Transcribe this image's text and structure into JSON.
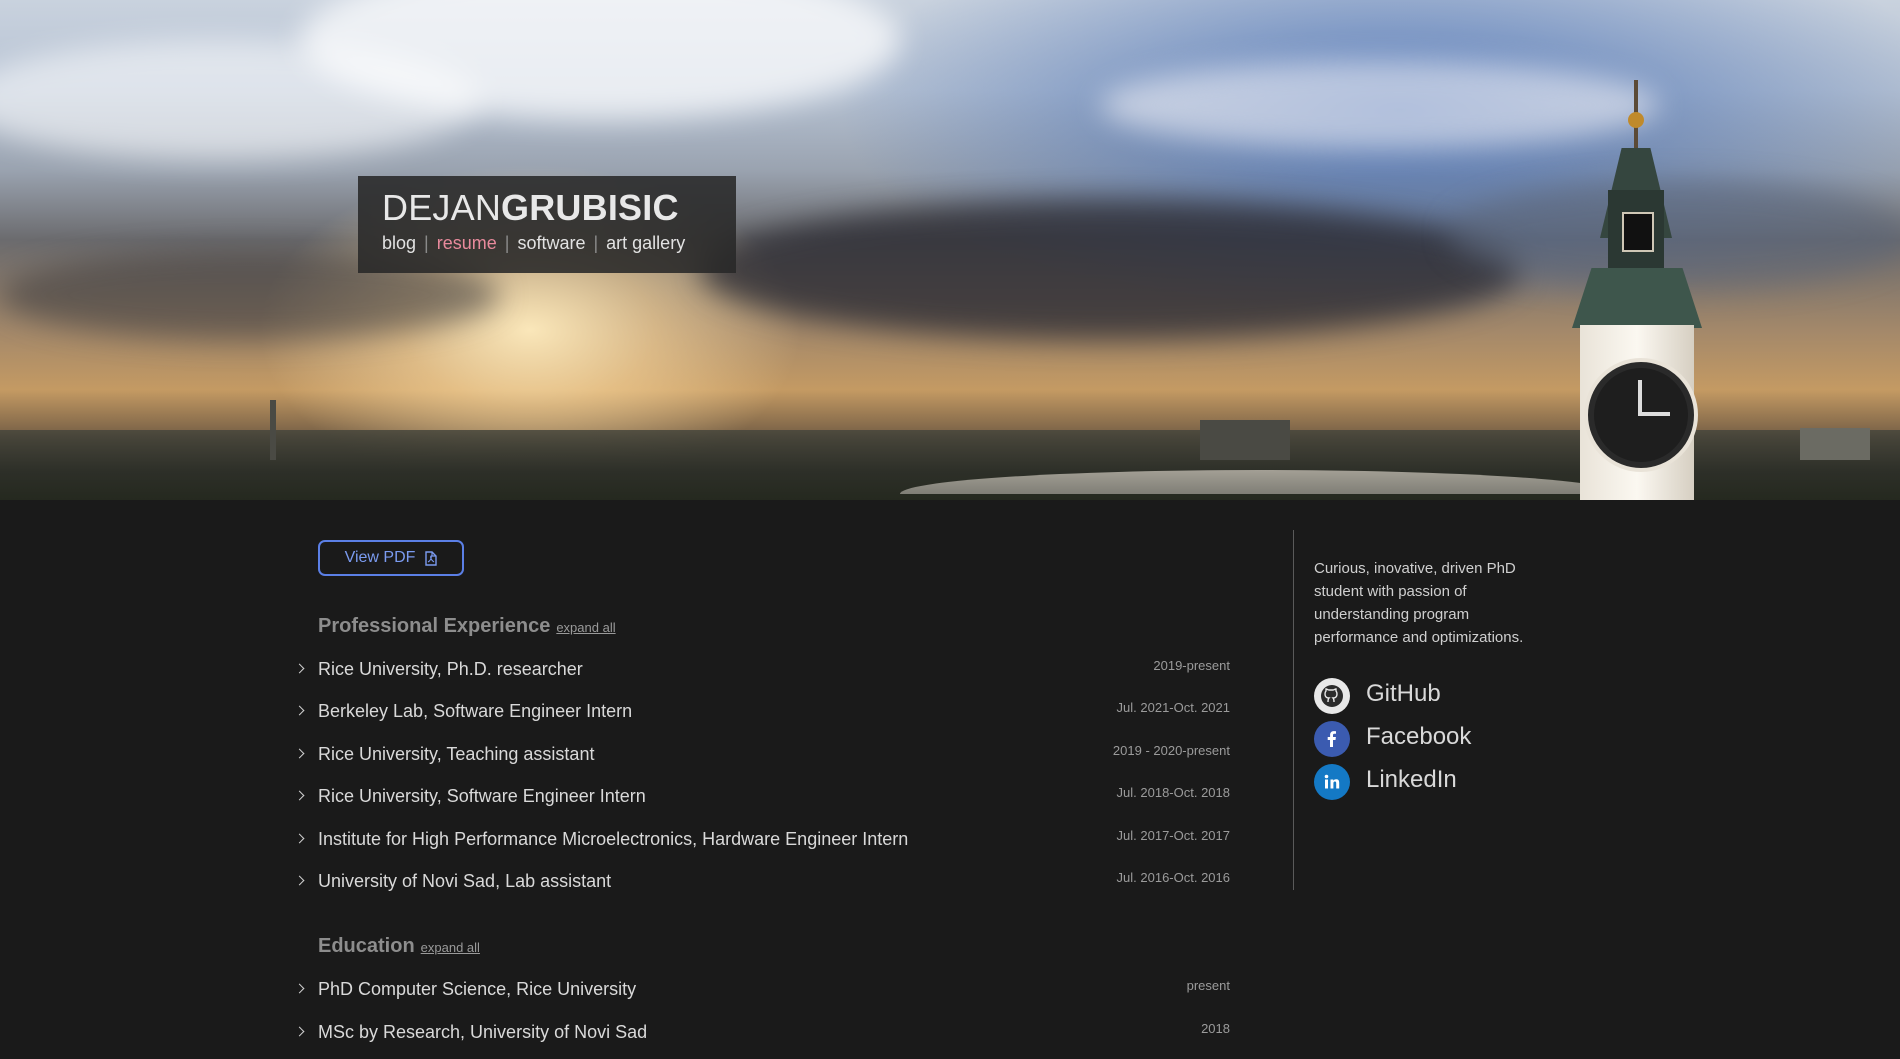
{
  "header": {
    "first_name": "DEJAN",
    "last_name": "GRUBISIC",
    "nav": [
      {
        "label": "blog"
      },
      {
        "label": "resume"
      },
      {
        "label": "software"
      },
      {
        "label": "art gallery"
      }
    ],
    "nav_separator": "|",
    "active_nav": "resume"
  },
  "resume": {
    "pdf_button": "View PDF",
    "experience": {
      "title": "Professional Experience",
      "expand_label": "expand all",
      "items": [
        {
          "title": "Rice University, Ph.D. researcher",
          "date": "2019-present"
        },
        {
          "title": "Berkeley Lab, Software Engineer Intern",
          "date": "Jul. 2021-Oct. 2021"
        },
        {
          "title": "Rice University, Teaching assistant",
          "date": "2019 - 2020-present"
        },
        {
          "title": "Rice University, Software Engineer Intern",
          "date": "Jul. 2018-Oct. 2018"
        },
        {
          "title": "Institute for High Performance Microelectronics, Hardware Engineer Intern",
          "date": "Jul. 2017-Oct. 2017"
        },
        {
          "title": "University of Novi Sad, Lab assistant",
          "date": "Jul. 2016-Oct. 2016"
        }
      ]
    },
    "education": {
      "title": "Education",
      "expand_label": "expand all",
      "items": [
        {
          "title": "PhD Computer Science, Rice University",
          "date": "present"
        },
        {
          "title": "MSc by Research, University of Novi Sad",
          "date": "2018"
        }
      ]
    }
  },
  "sidebar": {
    "bio": "Curious, inovative, driven PhD student with passion of understanding program performance and optimizations.",
    "social": [
      {
        "label": "GitHub",
        "icon": "github-icon",
        "color": "#e8e8e8"
      },
      {
        "label": "Facebook",
        "icon": "facebook-icon",
        "color": "#3b5bb0"
      },
      {
        "label": "LinkedIn",
        "icon": "linkedin-icon",
        "color": "#1479c5"
      }
    ]
  },
  "colors": {
    "background": "#1a1a1a",
    "active_nav": "#e88a9c",
    "pdf_button": "#5b7fe6"
  }
}
